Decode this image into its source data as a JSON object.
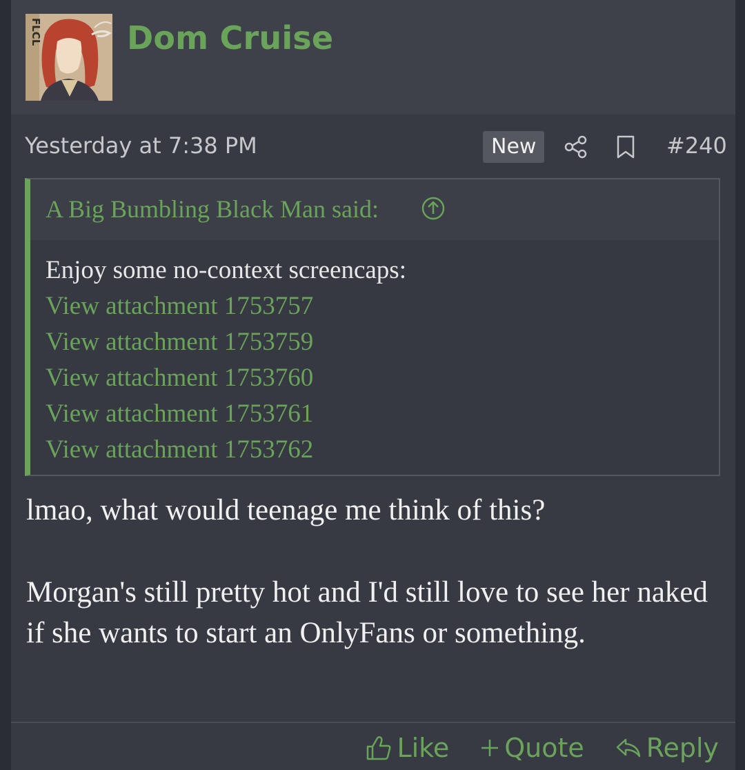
{
  "post": {
    "username": "Dom Cruise",
    "timestamp": "Yesterday at 7:38 PM",
    "badge": "New",
    "post_number": "#240",
    "avatar_text": "FLCL",
    "quote": {
      "author": "A Big Bumbling Black Man said:",
      "intro": "Enjoy some no-context screencaps:",
      "attachments": [
        "View attachment 1753757",
        "View attachment 1753759",
        "View attachment 1753760",
        "View attachment 1753761",
        "View attachment 1753762"
      ]
    },
    "body": {
      "line1": "lmao, what would teenage me think of this?",
      "paragraph2": "Morgan's still pretty hot and I'd still love to see her naked if she wants to start an OnlyFans or something."
    }
  },
  "actions": {
    "like": "Like",
    "quote": "Quote",
    "reply": "Reply"
  },
  "colors": {
    "accent": "#6aa35a",
    "post_bg": "#373a42",
    "header_bg": "#3e4149"
  },
  "icons": [
    "share-icon",
    "bookmark-icon",
    "arrow-up-circle-icon",
    "thumbs-up-icon",
    "plus-icon",
    "reply-icon"
  ]
}
